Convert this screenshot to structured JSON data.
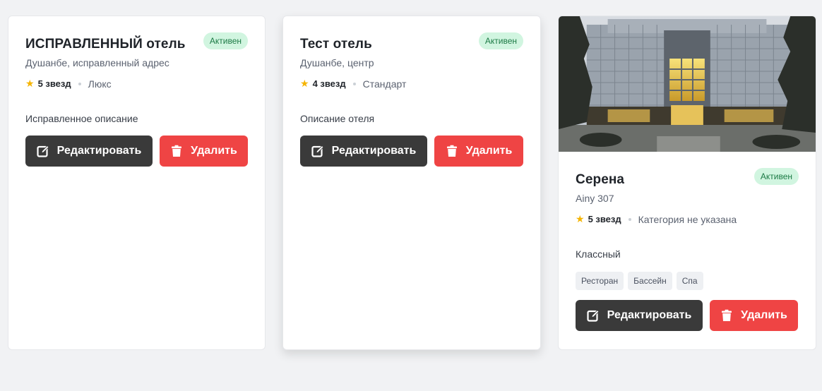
{
  "colors": {
    "page_bg": "#f1f2f4",
    "badge_bg": "#d1f5e0",
    "badge_text": "#1c7a45",
    "edit_button": "#3a3a3a",
    "delete_button": "#ef4444",
    "star": "#f5b400"
  },
  "hotels": [
    {
      "name": "ИСПРАВЛЕННЫЙ отель",
      "status": "Активен",
      "address": "Душанбе, исправленный адрес",
      "stars": "5 звезд",
      "category": "Люкс",
      "description": "Исправленное описание",
      "edit_label": "Редактировать",
      "delete_label": "Удалить"
    },
    {
      "name": "Тест отель",
      "status": "Активен",
      "address": "Душанбе, центр",
      "stars": "4 звезд",
      "category": "Стандарт",
      "description": "Описание отеля",
      "edit_label": "Редактировать",
      "delete_label": "Удалить"
    },
    {
      "name": "Серена",
      "status": "Активен",
      "address": "Ainy 307",
      "stars": "5 звезд",
      "category": "Категория не указана",
      "description": "Классный",
      "amenities": [
        "Ресторан",
        "Бассейн",
        "Спа"
      ],
      "edit_label": "Редактировать",
      "delete_label": "Удалить",
      "has_photo": true
    }
  ],
  "icons": {
    "star": "star-icon",
    "edit": "edit-icon",
    "delete": "trash-icon"
  }
}
